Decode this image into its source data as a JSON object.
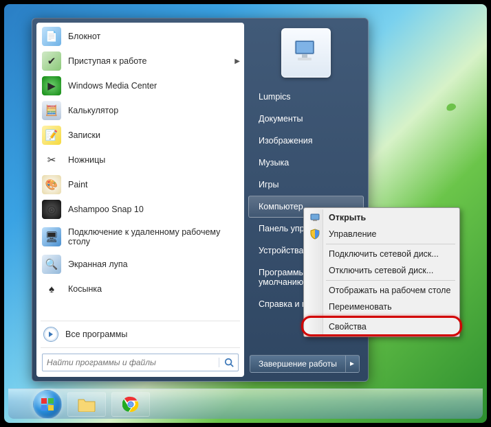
{
  "programs": [
    {
      "label": "Блокнот",
      "icon_bg": "linear-gradient(135deg,#bfe1fb,#6fb2e6)",
      "glyph": "📄",
      "has_submenu": false
    },
    {
      "label": "Приступая к работе",
      "icon_bg": "linear-gradient(135deg,#d0e9c6,#8cc97a)",
      "glyph": "✔",
      "has_submenu": true
    },
    {
      "label": "Windows Media Center",
      "icon_bg": "radial-gradient(circle,#6fcf6f,#128a12)",
      "glyph": "▶",
      "has_submenu": false
    },
    {
      "label": "Калькулятор",
      "icon_bg": "linear-gradient(180deg,#e9eef5,#b6c7dc)",
      "glyph": "🧮",
      "has_submenu": false
    },
    {
      "label": "Записки",
      "icon_bg": "linear-gradient(135deg,#fff2a8,#f5d93f)",
      "glyph": "📝",
      "has_submenu": false
    },
    {
      "label": "Ножницы",
      "icon_bg": "#fff",
      "glyph": "✂",
      "has_submenu": false
    },
    {
      "label": "Paint",
      "icon_bg": "radial-gradient(circle,#fff,#e8d9a8)",
      "glyph": "🎨",
      "has_submenu": false
    },
    {
      "label": "Ashampoo Snap 10",
      "icon_bg": "radial-gradient(circle,#555,#111)",
      "glyph": "◎",
      "has_submenu": false
    },
    {
      "label": "Подключение к удаленному рабочему столу",
      "icon_bg": "linear-gradient(135deg,#bcdffb,#4a8fcf)",
      "glyph": "🖥",
      "has_submenu": false,
      "tall": true
    },
    {
      "label": "Экранная лупа",
      "icon_bg": "linear-gradient(135deg,#e4eef8,#93b8da)",
      "glyph": "🔍",
      "has_submenu": false
    },
    {
      "label": "Косынка",
      "icon_bg": "#fff",
      "glyph": "♠",
      "has_submenu": false
    }
  ],
  "all_programs_label": "Все программы",
  "search_placeholder": "Найти программы и файлы",
  "right_items": [
    "Lumpics",
    "Документы",
    "Изображения",
    "Музыка",
    "Игры",
    "Компьютер",
    "Панель управления",
    "Устройства и принтеры",
    "Программы по умолчанию",
    "Справка и поддержка"
  ],
  "right_hover_index": 5,
  "shutdown_label": "Завершение работы",
  "context_menu": {
    "groups": [
      [
        {
          "label": "Открыть",
          "bold": true,
          "icon": "computer"
        },
        {
          "label": "Управление",
          "icon": "shield"
        }
      ],
      [
        {
          "label": "Подключить сетевой диск..."
        },
        {
          "label": "Отключить сетевой диск..."
        }
      ],
      [
        {
          "label": "Отображать на рабочем столе"
        },
        {
          "label": "Переименовать"
        }
      ],
      [
        {
          "label": "Свойства"
        }
      ]
    ]
  }
}
